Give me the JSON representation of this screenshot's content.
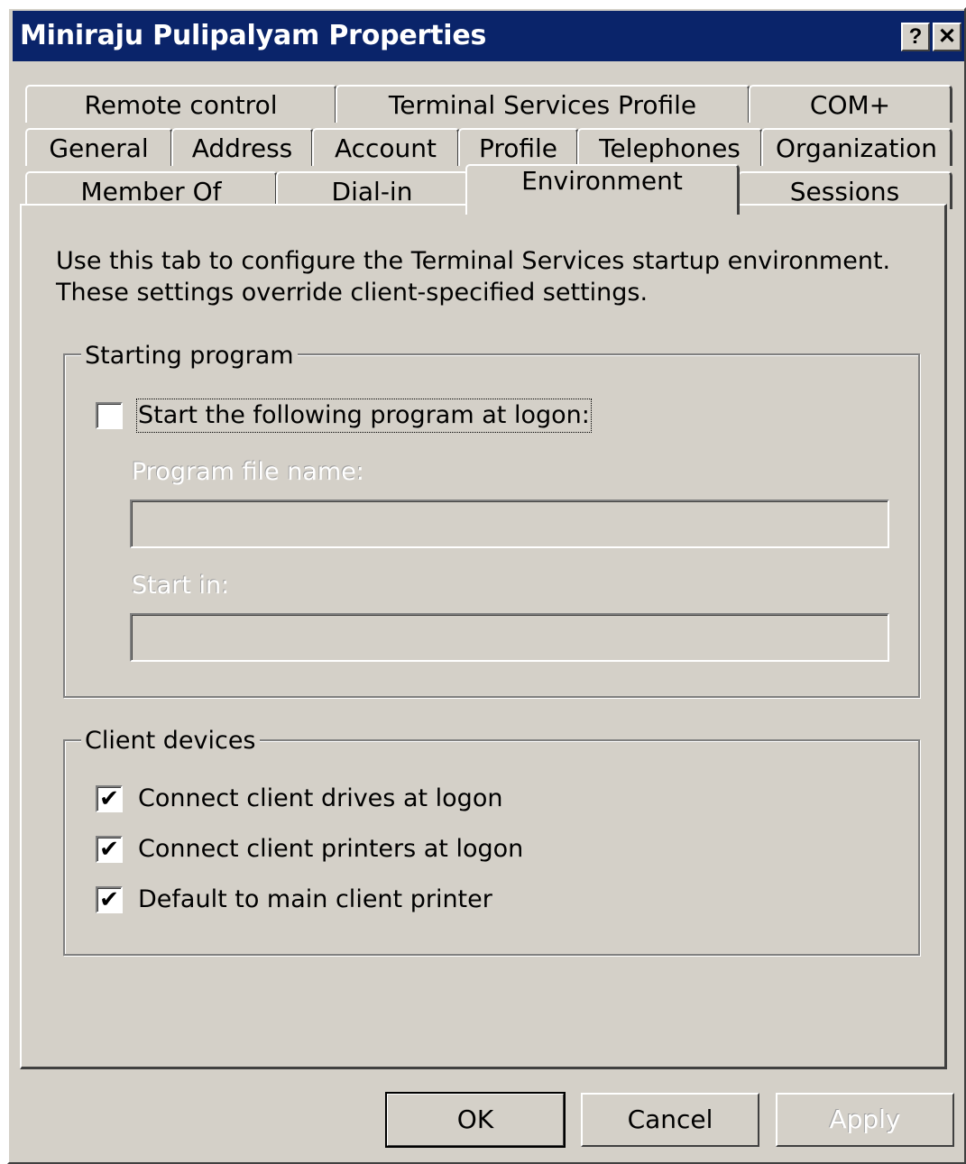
{
  "window": {
    "title": "Miniraju Pulipalyam Properties",
    "help_label": "?",
    "close_label": "✕"
  },
  "tabs": {
    "row1": [
      "Remote control",
      "Terminal Services Profile",
      "COM+"
    ],
    "row2": [
      "General",
      "Address",
      "Account",
      "Profile",
      "Telephones",
      "Organization"
    ],
    "row3": [
      "Member Of",
      "Dial-in",
      "Environment",
      "Sessions"
    ],
    "active": "Environment"
  },
  "description": "Use this tab to configure the Terminal Services startup environment. These settings override client-specified settings.",
  "starting_program": {
    "title": "Starting program",
    "start_checkbox": {
      "label": "Start the following program at logon:",
      "checked": false
    },
    "program_file_label": "Program file name:",
    "program_file_value": "",
    "start_in_label": "Start in:",
    "start_in_value": ""
  },
  "client_devices": {
    "title": "Client devices",
    "items": [
      {
        "label": "Connect client drives at logon",
        "checked": true
      },
      {
        "label": "Connect client printers at logon",
        "checked": true
      },
      {
        "label": "Default to main client printer",
        "checked": true
      }
    ]
  },
  "buttons": {
    "ok": "OK",
    "cancel": "Cancel",
    "apply": "Apply"
  }
}
